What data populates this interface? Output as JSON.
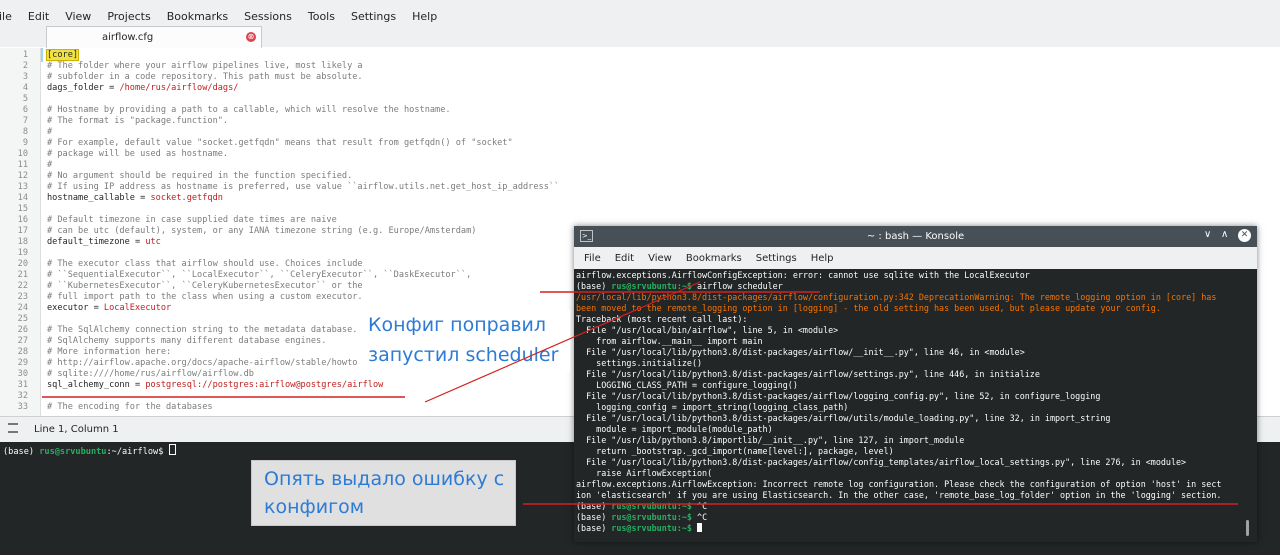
{
  "menubar": [
    "ile",
    "Edit",
    "View",
    "Projects",
    "Bookmarks",
    "Sessions",
    "Tools",
    "Settings",
    "Help"
  ],
  "tab": {
    "name": "airflow.cfg",
    "close": "⊗"
  },
  "editor_lines": [
    {
      "n": "1",
      "t": "[core]",
      "k": "hl"
    },
    {
      "n": "2",
      "t": "# The folder where your airflow pipelines live, most likely a",
      "k": "cm"
    },
    {
      "n": "3",
      "t": "# subfolder in a code repository. This path must be absolute.",
      "k": "cm"
    },
    {
      "n": "4",
      "t": "dags_folder = ",
      "v": "/home/rus/airflow/dags/"
    },
    {
      "n": "5",
      "t": "",
      "k": "cm"
    },
    {
      "n": "6",
      "t": "# Hostname by providing a path to a callable, which will resolve the hostname.",
      "k": "cm"
    },
    {
      "n": "7",
      "t": "# The format is \"package.function\".",
      "k": "cm"
    },
    {
      "n": "8",
      "t": "#",
      "k": "cm"
    },
    {
      "n": "9",
      "t": "# For example, default value \"socket.getfqdn\" means that result from getfqdn() of \"socket\"",
      "k": "cm"
    },
    {
      "n": "10",
      "t": "# package will be used as hostname.",
      "k": "cm"
    },
    {
      "n": "11",
      "t": "#",
      "k": "cm"
    },
    {
      "n": "12",
      "t": "# No argument should be required in the function specified.",
      "k": "cm"
    },
    {
      "n": "13",
      "t": "# If using IP address as hostname is preferred, use value ``airflow.utils.net.get_host_ip_address``",
      "k": "cm"
    },
    {
      "n": "14",
      "t": "hostname_callable = ",
      "v": "socket.getfqdn"
    },
    {
      "n": "15",
      "t": "",
      "k": "cm"
    },
    {
      "n": "16",
      "t": "# Default timezone in case supplied date times are naive",
      "k": "cm"
    },
    {
      "n": "17",
      "t": "# can be utc (default), system, or any IANA timezone string (e.g. Europe/Amsterdam)",
      "k": "cm"
    },
    {
      "n": "18",
      "t": "default_timezone = ",
      "v": "utc"
    },
    {
      "n": "19",
      "t": "",
      "k": "cm"
    },
    {
      "n": "20",
      "t": "# The executor class that airflow should use. Choices include",
      "k": "cm"
    },
    {
      "n": "21",
      "t": "# ``SequentialExecutor``, ``LocalExecutor``, ``CeleryExecutor``, ``DaskExecutor``,",
      "k": "cm"
    },
    {
      "n": "22",
      "t": "# ``KubernetesExecutor``, ``CeleryKubernetesExecutor`` or the",
      "k": "cm"
    },
    {
      "n": "23",
      "t": "# full import path to the class when using a custom executor.",
      "k": "cm"
    },
    {
      "n": "24",
      "t": "executor = ",
      "v": "LocalExecutor"
    },
    {
      "n": "25",
      "t": "",
      "k": "cm"
    },
    {
      "n": "26",
      "t": "# The SqlAlchemy connection string to the metadata database.",
      "k": "cm"
    },
    {
      "n": "27",
      "t": "# SqlAlchemy supports many different database engines.",
      "k": "cm"
    },
    {
      "n": "28",
      "t": "# More information here:",
      "k": "cm"
    },
    {
      "n": "29",
      "t": "# http://airflow.apache.org/docs/apache-airflow/stable/howto/set-up-database.html#database-uri",
      "k": "cm"
    },
    {
      "n": "30",
      "t": "# sqlite:////home/rus/airflow/airflow.db",
      "k": "cm"
    },
    {
      "n": "31",
      "t": "sql_alchemy_conn = ",
      "v": "postgresql://postgres:airflow@postgres/airflow"
    },
    {
      "n": "32",
      "t": "",
      "k": "cm"
    },
    {
      "n": "33",
      "t": "# The encoding for the databases",
      "k": "cm"
    }
  ],
  "status": {
    "position": "Line 1, Column 1"
  },
  "terminal": {
    "prompt_base": "(base) ",
    "prompt_user": "rus@srvubuntu",
    "prompt_path": ":~/airflow$ "
  },
  "konsole": {
    "title": "~ : bash — Konsole",
    "menu": [
      "File",
      "Edit",
      "View",
      "Bookmarks",
      "Settings",
      "Help"
    ],
    "lines": [
      {
        "t": "airflow.exceptions.AirflowConfigException: error: cannot use sqlite with the LocalExecutor"
      },
      {
        "p": "(base) ",
        "u": "rus@srvubuntu:~$",
        "t": " airflow scheduler"
      },
      {
        "o1": "/usr/local/lib/python3.8/dist-packages/airflow/configuration.py:342 DeprecationWarning:",
        "o2": " The remote_logging option in [core] has"
      },
      {
        "o2": "been moved to the remote_logging option in [logging] - the old setting has been used, but please update your config."
      },
      {
        "t": "Traceback (most recent call last):"
      },
      {
        "t": "  File \"/usr/local/bin/airflow\", line 5, in <module>"
      },
      {
        "t": "    from airflow.__main__ import main"
      },
      {
        "t": "  File \"/usr/local/lib/python3.8/dist-packages/airflow/__init__.py\", line 46, in <module>"
      },
      {
        "t": "    settings.initialize()"
      },
      {
        "t": "  File \"/usr/local/lib/python3.8/dist-packages/airflow/settings.py\", line 446, in initialize"
      },
      {
        "t": "    LOGGING_CLASS_PATH = configure_logging()"
      },
      {
        "t": "  File \"/usr/local/lib/python3.8/dist-packages/airflow/logging_config.py\", line 52, in configure_logging"
      },
      {
        "t": "    logging_config = import_string(logging_class_path)"
      },
      {
        "t": "  File \"/usr/local/lib/python3.8/dist-packages/airflow/utils/module_loading.py\", line 32, in import_string"
      },
      {
        "t": "    module = import_module(module_path)"
      },
      {
        "t": "  File \"/usr/lib/python3.8/importlib/__init__.py\", line 127, in import_module"
      },
      {
        "t": "    return _bootstrap._gcd_import(name[level:], package, level)"
      },
      {
        "t": "  File \"/usr/local/lib/python3.8/dist-packages/airflow/config_templates/airflow_local_settings.py\", line 276, in <module>"
      },
      {
        "t": "    raise AirflowException("
      },
      {
        "t": "airflow.exceptions.AirflowException: Incorrect remote log configuration. Please check the configuration of option 'host' in sect"
      },
      {
        "t": "ion 'elasticsearch' if you are using Elasticsearch. In the other case, 'remote_base_log_folder' option in the 'logging' section."
      },
      {
        "p": "(base) ",
        "u": "rus@srvubuntu:~$",
        "t": " ^C"
      },
      {
        "p": "(base) ",
        "u": "rus@srvubuntu:~$",
        "t": " ^C"
      },
      {
        "p": "(base) ",
        "u": "rus@srvubuntu:~$",
        "t": " ",
        "cursor": true
      }
    ]
  },
  "annotations": {
    "note1_line1": "Конфиг поправил",
    "note1_line2": "запустил scheduler",
    "note2_line1": "Опять выдало ошибку с",
    "note2_line2": "конфигом"
  },
  "colors": {
    "accent_red": "#d42020",
    "note_blue": "#2d7bd4",
    "prompt_green": "#27ae60",
    "warning_orange": "#f67400"
  }
}
